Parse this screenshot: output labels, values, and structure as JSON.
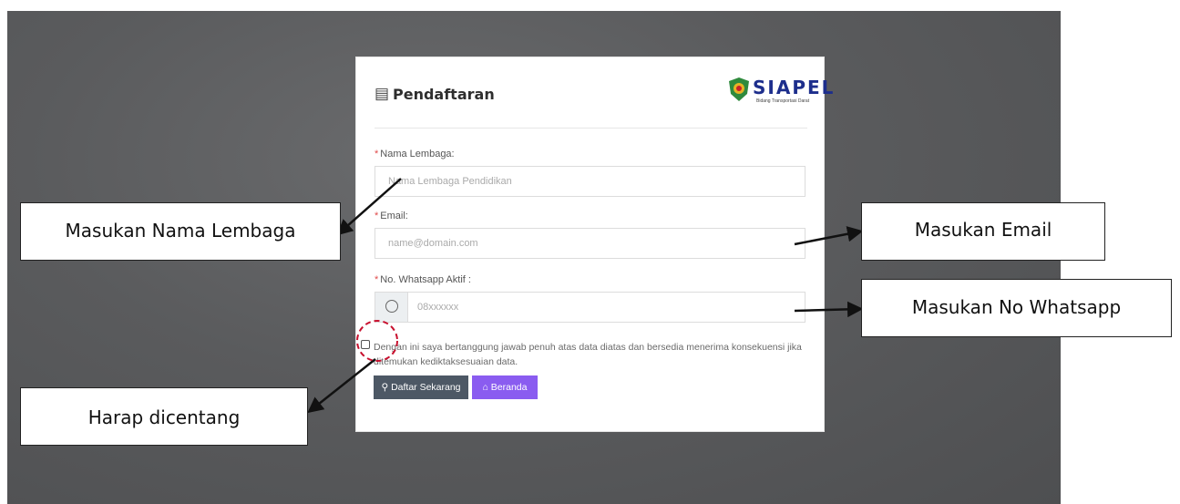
{
  "form": {
    "title": "Pendaftaran",
    "title_icon": "form-icon",
    "logo": {
      "text": "SIAPEL",
      "subtitle": "Bidang Transportasi Darat",
      "emblem_colors": [
        "#2f8a3d",
        "#e6b325",
        "#c8202a"
      ]
    },
    "fields": [
      {
        "label": "Nama Lembaga:",
        "placeholder": "Nama Lembaga Pendidikan"
      },
      {
        "label": "Email:",
        "placeholder": "name@domain.com"
      },
      {
        "label": "No. Whatsapp Aktif :",
        "placeholder": "08xxxxxx",
        "icon": "whatsapp-icon"
      }
    ],
    "required_marker": "*",
    "agreement": "Dengan ini saya bertanggung jawab penuh atas data diatas dan bersedia menerima konsekuensi jika ditemukan kediktaksesuaian data.",
    "buttons": [
      {
        "label": "Daftar Sekarang",
        "icon": "signpost-icon"
      },
      {
        "label": "Beranda",
        "icon": "home-icon"
      }
    ]
  },
  "callouts": {
    "nama": "Masukan Nama Lembaga",
    "email": "Masukan Email",
    "whatsapp": "Masukan No Whatsapp",
    "centang": "Harap dicentang"
  },
  "colors": {
    "background": "#5a5b5d",
    "primary_button": "#4d5865",
    "secondary_button": "#8a5cf0",
    "required": "#e04a4a",
    "highlight_circle": "#c8102e"
  }
}
